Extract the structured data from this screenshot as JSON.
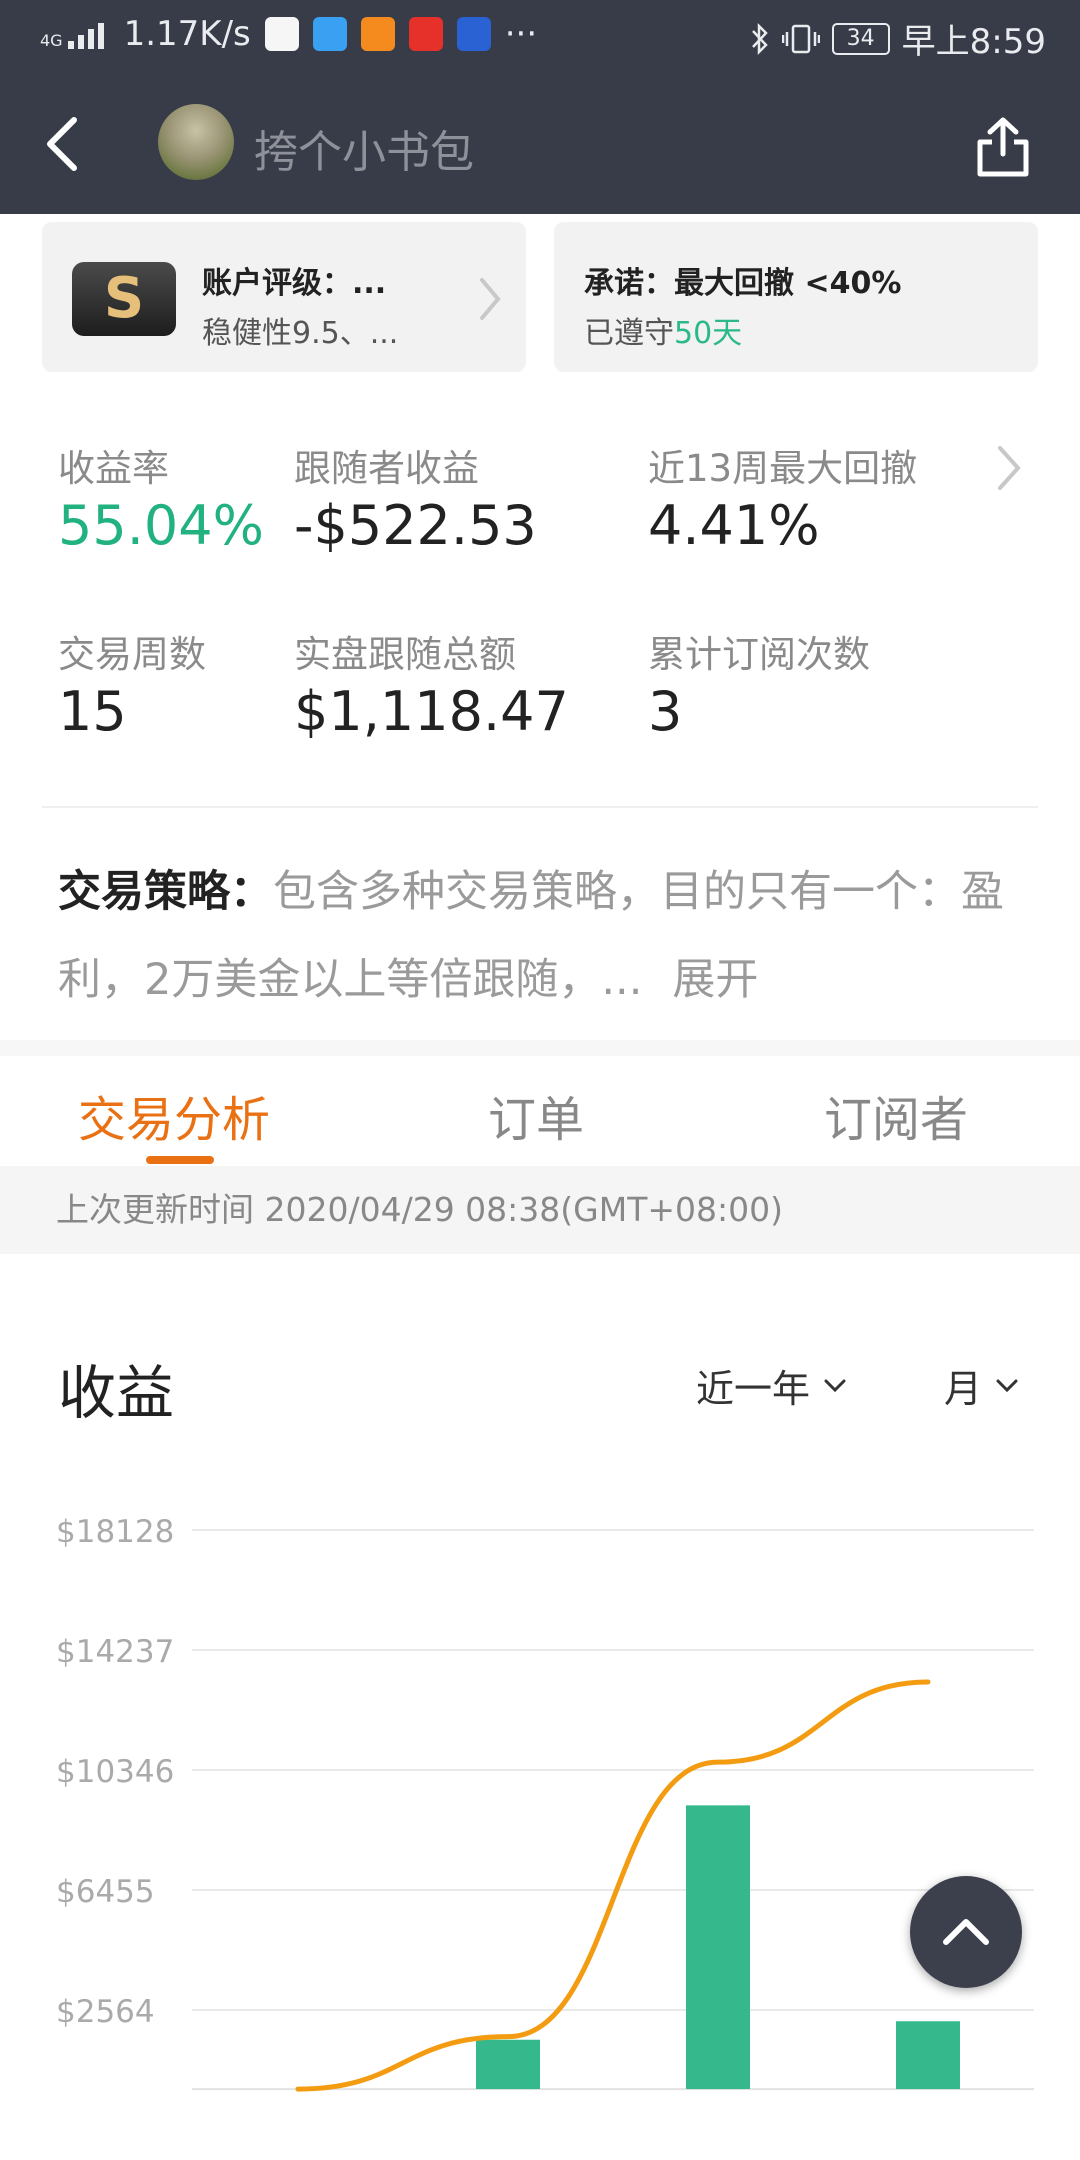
{
  "status_bar": {
    "network": "4G",
    "speed": "1.17K/s",
    "more": "···",
    "battery": "34",
    "time": "早上8:59"
  },
  "header": {
    "profile_name": "挎个小书包",
    "back_icon": "chevron-left-icon",
    "share_icon": "share-icon"
  },
  "cards": {
    "rating": {
      "badge": "S",
      "title": "账户评级：...",
      "subtitle": "稳健性9.5、..."
    },
    "promise": {
      "title": "承诺：最大回撤 <40%",
      "subtitle_prefix": "已遵守",
      "days": "50天"
    }
  },
  "stats": {
    "return_label": "收益率",
    "return_value": "55.04%",
    "follower_profit_label": "跟随者收益",
    "follower_profit_value": "-$522.53",
    "max_drawdown_label": "近13周最大回撤",
    "max_drawdown_value": "4.41%",
    "weeks_label": "交易周数",
    "weeks_value": "15",
    "live_follow_label": "实盘跟随总额",
    "live_follow_value": "$1,118.47",
    "subscriptions_label": "累计订阅次数",
    "subscriptions_value": "3"
  },
  "strategy": {
    "title": "交易策略：",
    "text": "包含多种交易策略，目的只有一个：盈利，2万美金以上等倍跟随，...",
    "expand": "展开"
  },
  "tabs": [
    "交易分析",
    "订单",
    "订阅者"
  ],
  "update": {
    "text": "上次更新时间 2020/04/29 08:38(GMT+08:00)"
  },
  "chart_section": {
    "title": "收益",
    "period": "近一年",
    "granularity": "月"
  },
  "chart_data": {
    "type": "bar",
    "title": "收益",
    "y_ticks": [
      "$18128",
      "$14237",
      "$10346",
      "$6455",
      "$2564"
    ],
    "ylim": [
      -1327,
      18128
    ],
    "categories": [
      "",
      "",
      "",
      ""
    ],
    "series": [
      {
        "values": [
          0,
          1600,
          9200,
          2200
        ],
        "color": "#35b98c"
      },
      {
        "type": "line",
        "values": [
          0,
          1700,
          10600,
          13200
        ],
        "color": "#f39c12"
      }
    ],
    "grid": true
  },
  "colors": {
    "header_bg": "#383c48",
    "accent_orange": "#ea7113",
    "positive_green": "#21b27f",
    "bar_green": "#35b98c",
    "line_orange": "#f39c12"
  },
  "fab": {
    "icon": "chevron-up-icon"
  }
}
